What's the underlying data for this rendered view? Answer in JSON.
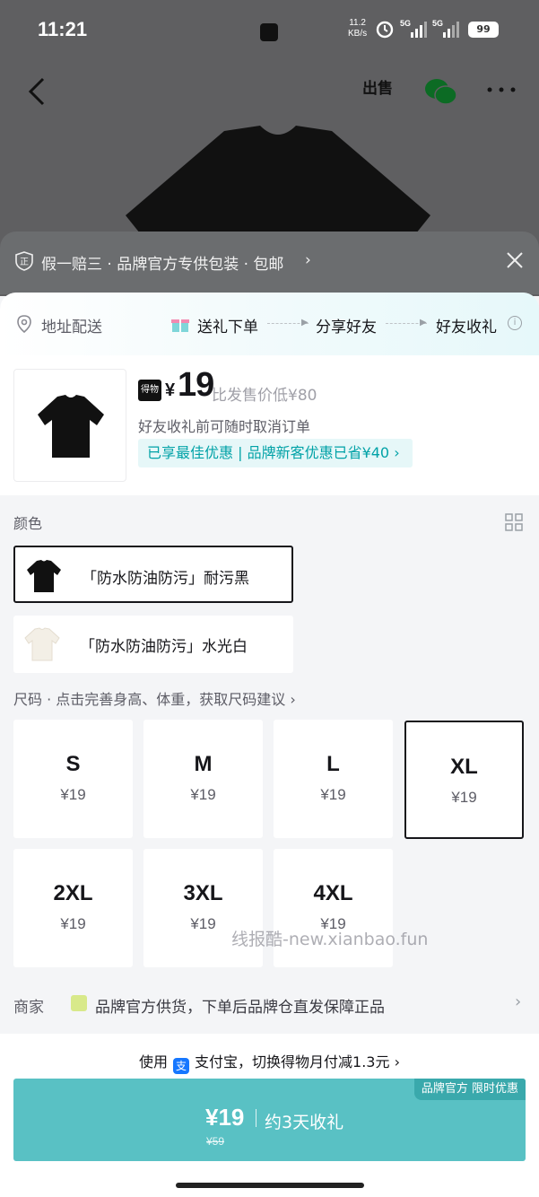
{
  "status_bar": {
    "time": "11:21",
    "net_speed": "11.2",
    "net_unit": "KB/s",
    "battery": "99"
  },
  "topnav": {
    "sell_label": "出售"
  },
  "banner": {
    "text": "假一赔三 · 品牌官方专供包装 · 包邮",
    "chevron": "›"
  },
  "gift_bar": {
    "address_label": "地址配送",
    "steps": [
      "送礼下单",
      "分享好友",
      "好友收礼"
    ]
  },
  "product": {
    "brand_logo": "得物",
    "currency": "¥",
    "price": "19",
    "compare": "比发售价低¥80",
    "note": "好友收礼前可随时取消订单",
    "promo": "已享最佳优惠 | 品牌新客优惠已省¥40 ›"
  },
  "color_section": {
    "label": "颜色",
    "options": [
      {
        "label": "「防水防油防污」耐污黑",
        "selected": true
      },
      {
        "label": "「防水防油防污」水光白",
        "selected": false
      }
    ]
  },
  "size_section": {
    "label": "尺码 · 点击完善身高、体重，获取尺码建议 ›",
    "options": [
      {
        "size": "S",
        "price": "¥19"
      },
      {
        "size": "M",
        "price": "¥19"
      },
      {
        "size": "L",
        "price": "¥19"
      },
      {
        "size": "XL",
        "price": "¥19"
      },
      {
        "size": "2XL",
        "price": "¥19"
      },
      {
        "size": "3XL",
        "price": "¥19"
      },
      {
        "size": "4XL",
        "price": "¥19"
      }
    ],
    "selected": "XL"
  },
  "watermark": "线报酷-new.xianbao.fun",
  "merchant": {
    "label": "商家",
    "text": "品牌官方供货，下单后品牌仓直发保障正品"
  },
  "bottom": {
    "alipay_prefix": "使用",
    "alipay_icon": "支",
    "alipay_text": "支付宝，切换得物月付减1.3元 ›",
    "buy_tag": "品牌官方 限时优惠",
    "buy_price": "¥19",
    "buy_desc": "约3天收礼",
    "buy_old_price": "¥59"
  },
  "colors": {
    "accent": "#59c1c4",
    "promo_text": "#01a2a7",
    "backdrop": "#5f5f61"
  }
}
